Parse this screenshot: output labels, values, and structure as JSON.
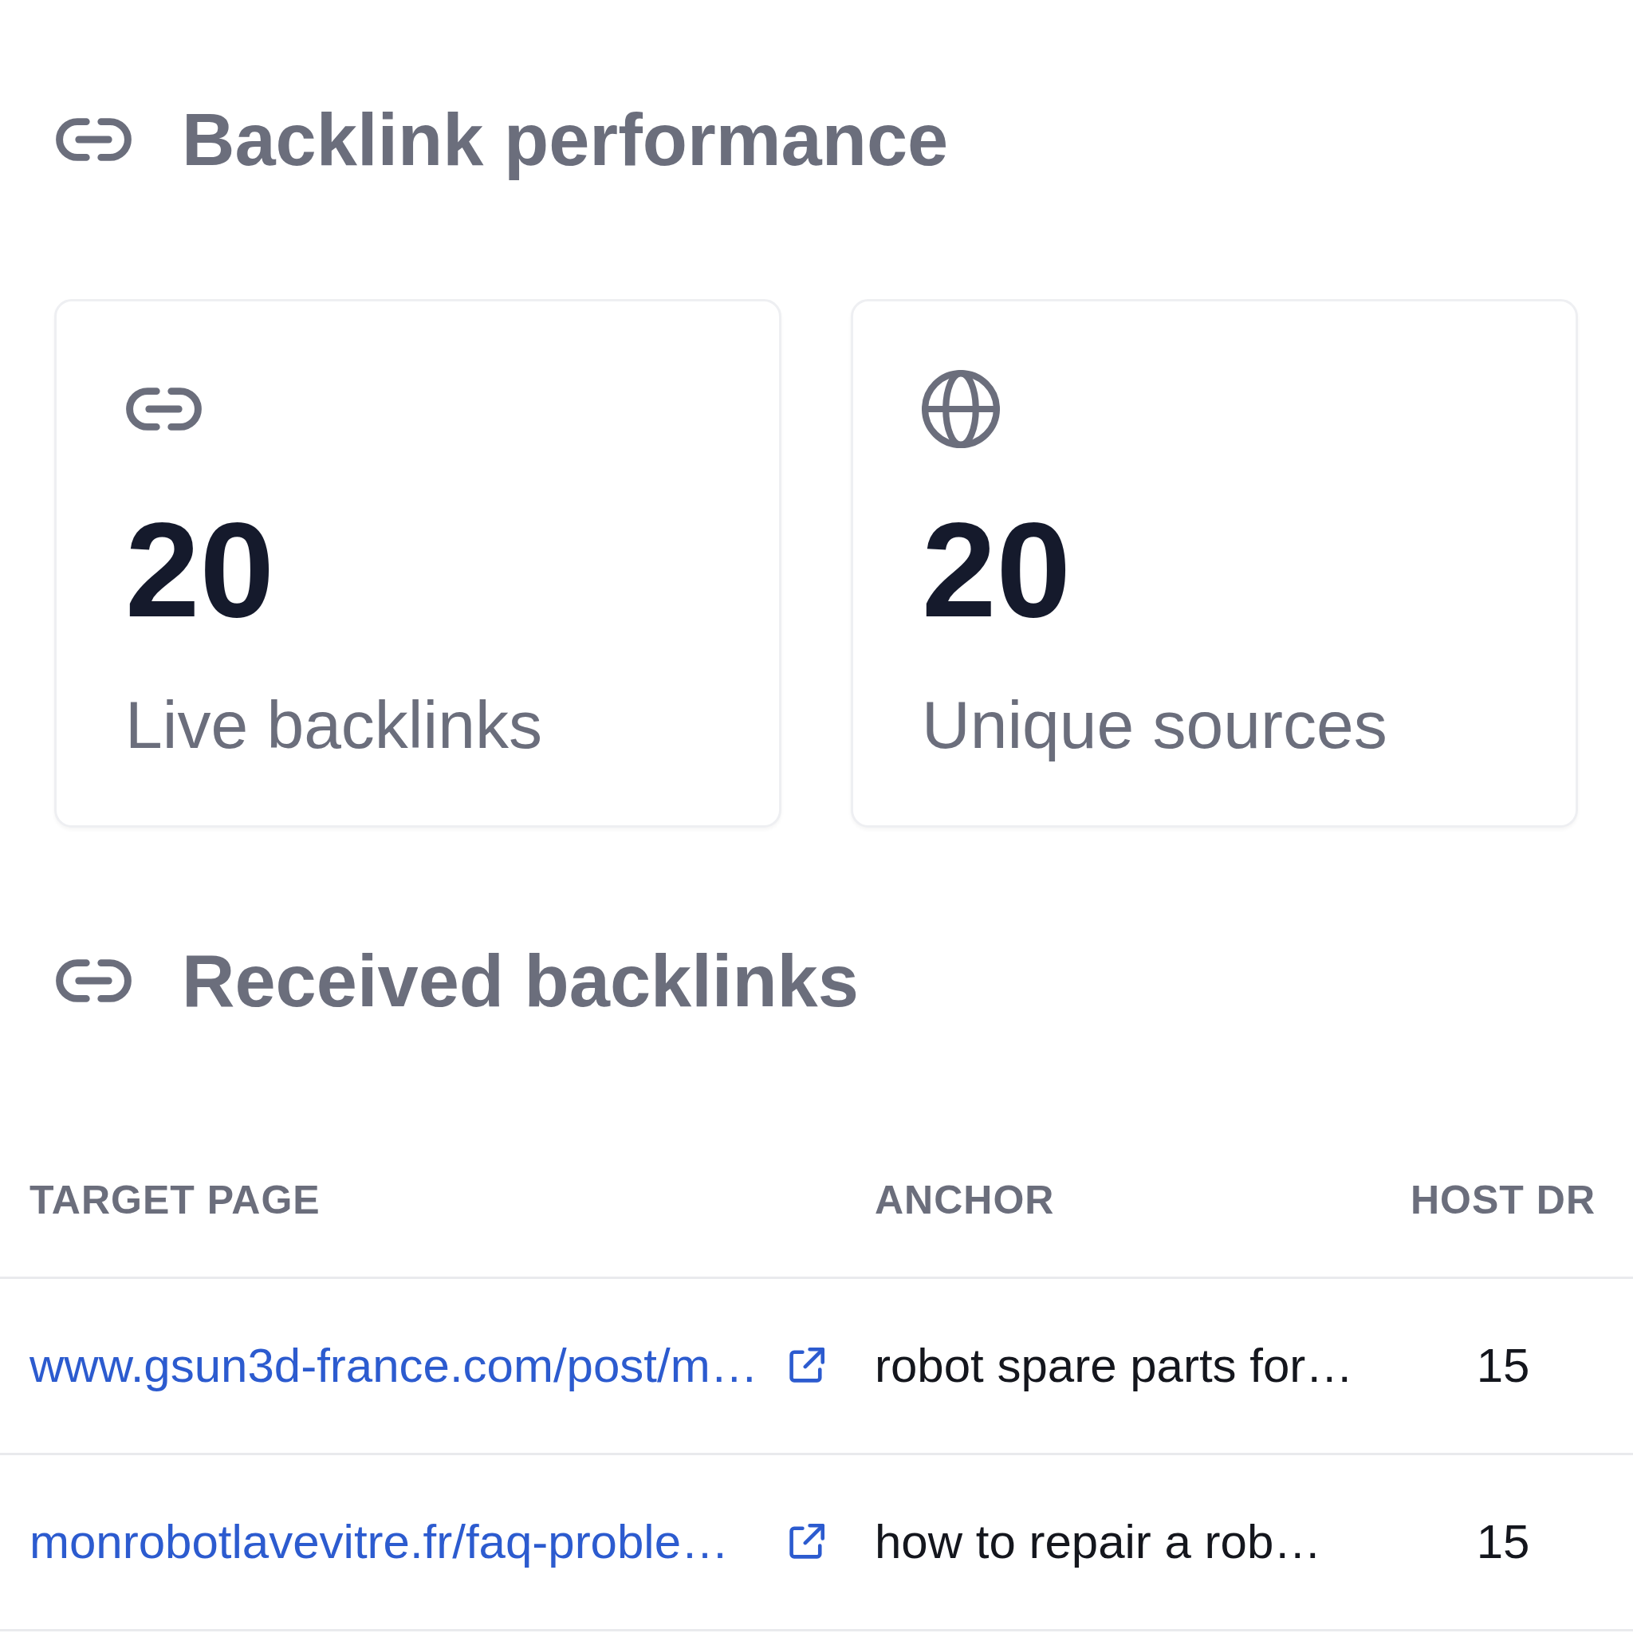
{
  "backlink_performance": {
    "title": "Backlink performance",
    "cards": [
      {
        "kind": "links",
        "value": "20",
        "label": "Live backlinks"
      },
      {
        "kind": "sources",
        "value": "20",
        "label": "Unique sources"
      }
    ]
  },
  "received_backlinks": {
    "title": "Received backlinks",
    "table": {
      "columns": [
        "TARGET PAGE",
        "ANCHOR",
        "HOST DR"
      ],
      "rows": [
        {
          "target_page": "www.gsun3d-france.com/post/m…",
          "anchor": "robot spare parts for…",
          "host_dr": "15"
        },
        {
          "target_page": "monrobotlavevitre.fr/faq-proble…",
          "anchor": "how to repair a rob…",
          "host_dr": "15"
        }
      ]
    }
  }
}
